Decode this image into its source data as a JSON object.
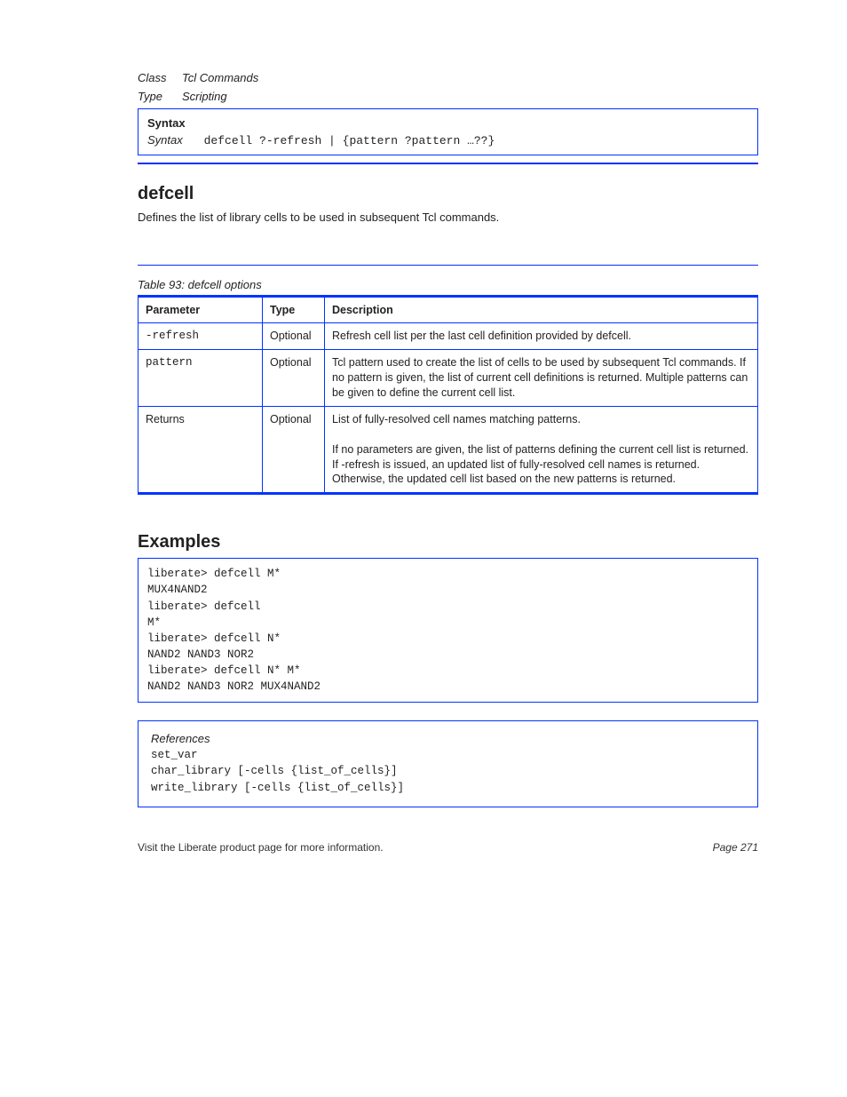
{
  "header": {
    "class_label": "Class",
    "class_value": "Tcl Commands",
    "type_label": "Type",
    "type_value": "Scripting"
  },
  "syntax_box": {
    "title": "Syntax",
    "label": "Syntax",
    "code": "defcell ?-refresh | {pattern ?pattern …??}"
  },
  "section1": {
    "title": "defcell",
    "para": "Defines the list of library cells to be used in subsequent Tcl commands."
  },
  "table": {
    "caption": "Table 93: defcell options",
    "headers": [
      "Parameter",
      "Type",
      "Description"
    ],
    "rows": [
      {
        "p": "-refresh",
        "t": "Optional",
        "d": "Refresh cell list per the last cell definition provided by defcell."
      },
      {
        "p": "pattern",
        "t": "Optional",
        "d": "Tcl pattern used to create the list of cells to be used by subsequent Tcl commands. If no pattern is given, the list of current cell definitions is returned. Multiple patterns can be given to define the current cell list."
      },
      {
        "p": "Returns",
        "t": "Optional",
        "d0": "List of fully-resolved cell names matching patterns.",
        "d1": "If no parameters are given, the list of patterns defining the current cell list is returned. If -refresh is issued, an updated list of fully-resolved cell names is returned. Otherwise, the updated cell list based on the new patterns is returned."
      }
    ]
  },
  "examples": {
    "title": "Examples",
    "code": "liberate> defcell M*\nMUX4NAND2\nliberate> defcell\nM*\nliberate> defcell N*\nNAND2 NAND3 NOR2\nliberate> defcell N* M*\nNAND2 NAND3 NOR2 MUX4NAND2"
  },
  "references": {
    "label": "References",
    "code": "set_var\nchar_library [-cells {list_of_cells}]\nwrite_library [-cells {list_of_cells}]"
  },
  "footer": {
    "left": "Visit the Liberate product page for more information.",
    "right": "Page 271"
  }
}
